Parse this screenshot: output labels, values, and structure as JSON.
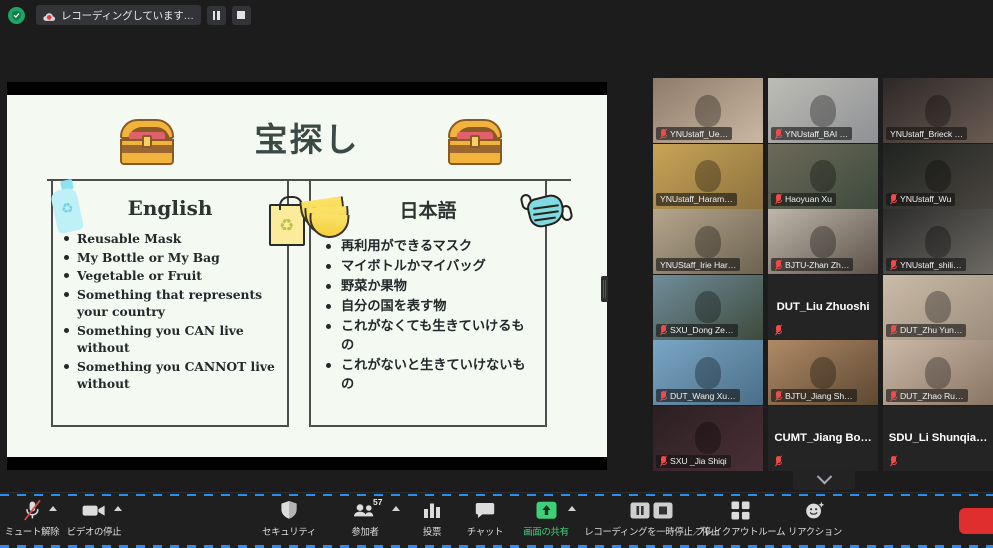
{
  "topbar": {
    "shield_icon": "shield-icon",
    "recording_label": "レコーディングしています…",
    "pause_icon": "pause-icon",
    "stop_icon": "stop-icon"
  },
  "slide": {
    "title": "宝探し",
    "left_column": {
      "heading": "English",
      "bullets": [
        "Reusable Mask",
        "My Bottle or My Bag",
        "Vegetable or Fruit",
        "Something that represents your country",
        "Something you CAN live without",
        "Something you CANNOT live without"
      ]
    },
    "right_column": {
      "heading": "日本語",
      "bullets": [
        "再利用ができるマスク",
        "マイボトルかマイバッグ",
        "野菜か果物",
        "自分の国を表す物",
        "これがなくても生きていけるもの",
        "これがないと生きていけないもの"
      ]
    },
    "art": [
      "treasure-chest-icon",
      "treasure-chest-icon",
      "bottle-icon",
      "shopping-bag-icon",
      "banana-icon",
      "face-mask-icon"
    ]
  },
  "grid": {
    "rows": [
      [
        {
          "name": "YNUstaff_Ue…",
          "muted": true,
          "camera": true,
          "active": false
        },
        {
          "name": "YNUstaff_BAI …",
          "muted": true,
          "camera": true,
          "active": false
        },
        {
          "name": "YNUstaff_Brieck …",
          "muted": false,
          "camera": true,
          "active": false
        }
      ],
      [
        {
          "name": "YNUstaff_Haram…",
          "muted": false,
          "camera": true,
          "active": true
        },
        {
          "name": "Haoyuan Xu",
          "muted": true,
          "camera": true,
          "active": false
        },
        {
          "name": "YNUstaff_Wu",
          "muted": true,
          "camera": true,
          "active": false
        }
      ],
      [
        {
          "name": "YNUStaff_Irie Har…",
          "muted": false,
          "camera": true,
          "active": false
        },
        {
          "name": "BJTU-Zhan Zh…",
          "muted": true,
          "camera": true,
          "active": false
        },
        {
          "name": "YNUstaff_shili…",
          "muted": true,
          "camera": true,
          "active": false
        }
      ],
      [
        {
          "name": "SXU_Dong Ze…",
          "muted": true,
          "camera": true,
          "active": false
        },
        {
          "name": "DUT_Liu Zhuoshi",
          "muted": true,
          "camera": false,
          "active": false
        },
        {
          "name": "DUT_Zhu Yun…",
          "muted": true,
          "camera": true,
          "active": false
        }
      ],
      [
        {
          "name": "DUT_Wang Xu…",
          "muted": true,
          "camera": true,
          "active": false
        },
        {
          "name": "BJTU_Jiang Sh…",
          "muted": true,
          "camera": true,
          "active": false
        },
        {
          "name": "DUT_Zhao Ru…",
          "muted": true,
          "camera": true,
          "active": false
        }
      ],
      [
        {
          "name": "SXU _Jia Shiqi",
          "muted": true,
          "camera": true,
          "active": false
        },
        {
          "name": "CUMT_Jiang Bo…",
          "muted": true,
          "camera": false,
          "active": false
        },
        {
          "name": "SDU_Li Shunqia…",
          "muted": true,
          "camera": false,
          "active": false
        }
      ]
    ],
    "scroll_down_icon": "chevron-down-icon"
  },
  "toolbar": {
    "mute": {
      "label": "ミュート解除",
      "icon": "microphone-muted-icon"
    },
    "video": {
      "label": "ビデオの停止",
      "icon": "video-camera-icon"
    },
    "security": {
      "label": "セキュリティ",
      "icon": "shield-icon"
    },
    "participants": {
      "label": "参加者",
      "icon": "people-icon",
      "count": "57"
    },
    "polls": {
      "label": "投票",
      "icon": "bar-chart-icon"
    },
    "chat": {
      "label": "チャット",
      "icon": "chat-bubble-icon"
    },
    "share": {
      "label": "画面の共有",
      "icon": "share-screen-icon",
      "accent": "#45d07c"
    },
    "recording": {
      "label": "レコーディングを一時停止／停止",
      "icon": "pause-stop-icon"
    },
    "breakout": {
      "label": "ブレイクアウトルーム",
      "icon": "grid-squares-icon"
    },
    "reactions": {
      "label": "リアクション",
      "icon": "smiley-reaction-icon"
    },
    "end": {
      "icon": "end-meeting-button"
    }
  }
}
